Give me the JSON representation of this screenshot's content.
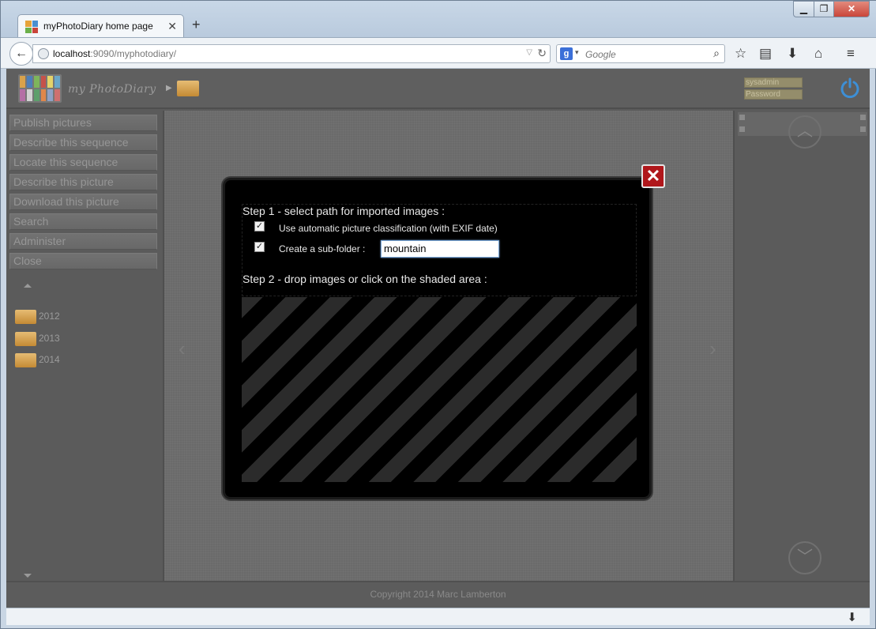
{
  "browser": {
    "tab_title": "myPhotoDiary home page",
    "url_host": "localhost",
    "url_rest": ":9090/myphotodiary/",
    "search_placeholder": "Google"
  },
  "app": {
    "logo_text": "my PhotoDiary",
    "username": "sysadmin",
    "password_placeholder": "Password"
  },
  "menu": [
    {
      "label": "Publish pictures"
    },
    {
      "label": "Describe this sequence"
    },
    {
      "label": "Locate this sequence"
    },
    {
      "label": "Describe this picture"
    },
    {
      "label": "Download this picture"
    },
    {
      "label": "Search"
    },
    {
      "label": "Administer"
    },
    {
      "label": "Close"
    }
  ],
  "tree": [
    {
      "label": "2012"
    },
    {
      "label": "2013"
    },
    {
      "label": "2014"
    }
  ],
  "footer": {
    "copyright": "Copyright 2014 Marc Lamberton"
  },
  "modal": {
    "close_label": "✕",
    "step1": "Step 1 - select path for imported images :",
    "auto_classification_label": "Use automatic picture classification (with EXIF date)",
    "auto_classification_checked": "✓",
    "subfolder_label": "Create a sub-folder :",
    "subfolder_checked": "✓",
    "subfolder_value": "mountain",
    "step2": "Step 2 - drop images or click on the shaded area :"
  },
  "colors": {
    "page_bg": "#5b5b5b",
    "close_red": "#b0171b",
    "accent_blue": "#3d8fd6"
  }
}
